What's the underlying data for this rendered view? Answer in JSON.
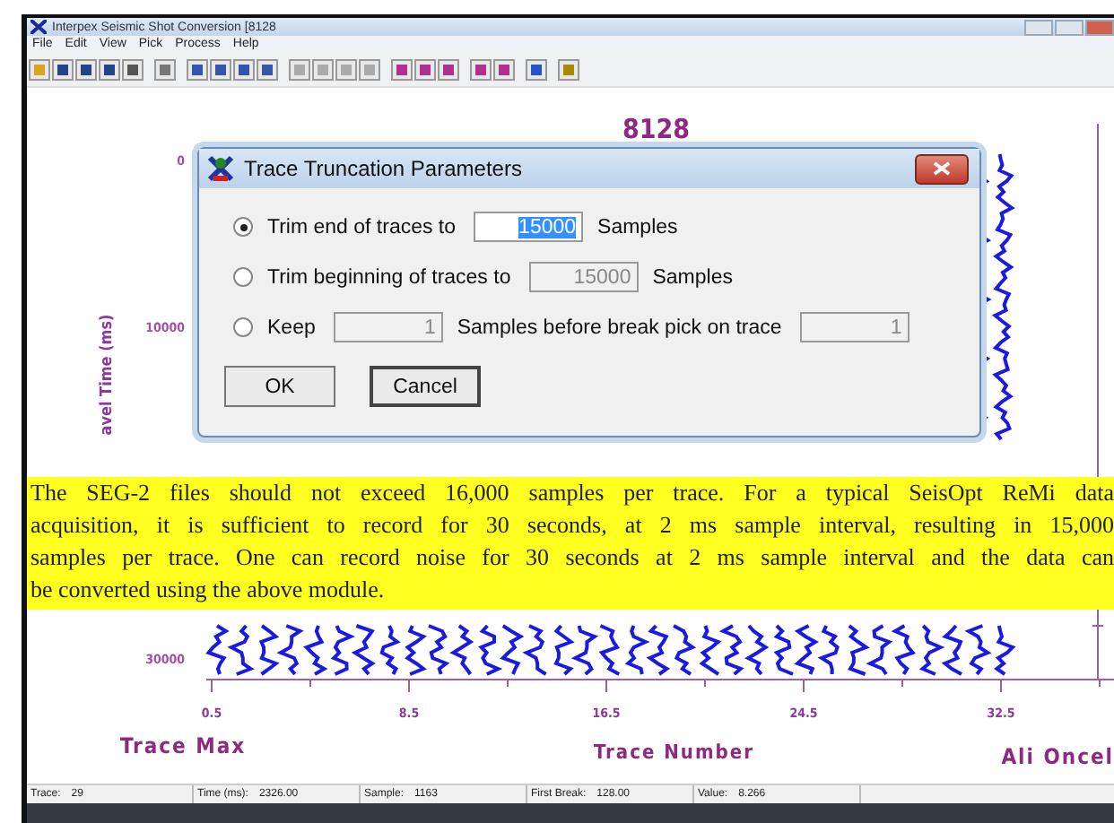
{
  "window": {
    "title": "Interpex Seismic Shot Conversion [8128"
  },
  "menu": [
    "File",
    "Edit",
    "View",
    "Pick",
    "Process",
    "Help"
  ],
  "plot": {
    "title": "8128",
    "y_ticks": [
      "0",
      "10000",
      "30000"
    ],
    "y_label": "avel Time (ms)",
    "x_ticks": [
      "0.5",
      "8.5",
      "16.5",
      "24.5",
      "32.5"
    ],
    "left_label": "Trace Max",
    "x_label": "Trace Number",
    "right_label": "Ali Oncel"
  },
  "dialog": {
    "title": "Trace Truncation Parameters",
    "options": [
      {
        "kind": "single",
        "selected": true,
        "label": "Trim end of traces to",
        "value": "15000",
        "value_highlighted": true,
        "disabled": false,
        "unit": "Samples"
      },
      {
        "kind": "single",
        "selected": false,
        "label": "Trim beginning of traces to",
        "value": "15000",
        "value_highlighted": false,
        "disabled": true,
        "unit": "Samples"
      },
      {
        "kind": "double",
        "selected": false,
        "label": "Keep",
        "value": "1",
        "value_highlighted": false,
        "disabled": true,
        "unit": "Samples before break pick on trace",
        "value_2": "1"
      }
    ],
    "buttons": [
      "OK",
      "Cancel"
    ]
  },
  "note": [
    "The SEG-2 files should not exceed 16,000 samples per trace. For a typical SeisOpt ReMi data",
    "acquisition, it is sufficient to record for 30 seconds, at 2 ms sample interval, resulting in 15,000",
    "samples per trace. One can record noise for 30 seconds at 2 ms sample interval and the data can",
    "be converted using the above module."
  ],
  "status_bar": [
    {
      "label": "Trace:",
      "value": "29"
    },
    {
      "label": "Time (ms):",
      "value": "2326.00"
    },
    {
      "label": "Sample:",
      "value": "1163"
    },
    {
      "label": "First Break:",
      "value": "128.00"
    },
    {
      "label": "Value:",
      "value": "8.266"
    }
  ]
}
